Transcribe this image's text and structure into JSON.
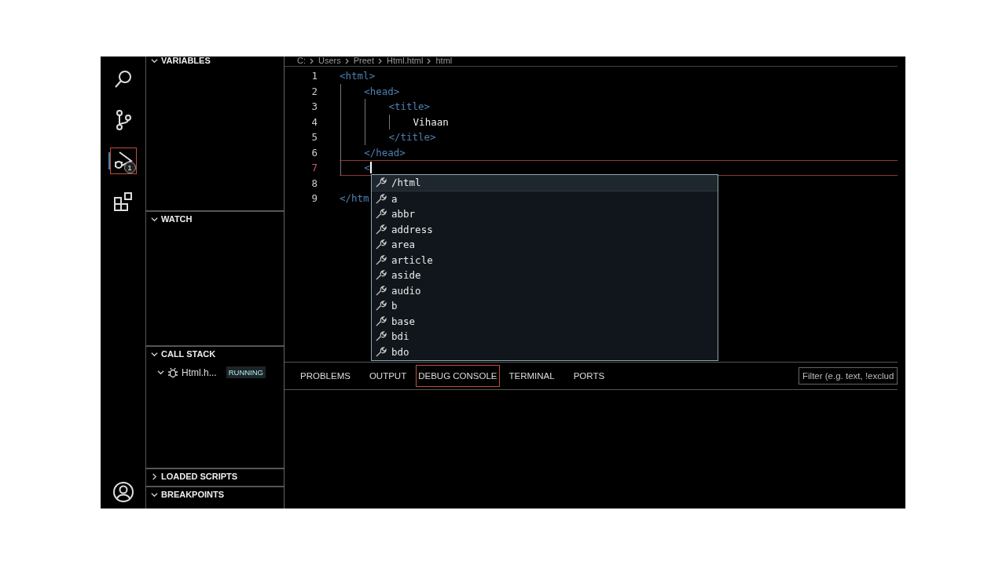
{
  "activity_bar": {
    "items": [
      {
        "kind": "search",
        "selected": false
      },
      {
        "kind": "source-control",
        "selected": false
      },
      {
        "kind": "run-debug",
        "selected": true,
        "badge": "1"
      },
      {
        "kind": "extensions",
        "selected": false
      }
    ],
    "account": {
      "kind": "account"
    }
  },
  "sidebar": {
    "sections": [
      {
        "title": "VARIABLES",
        "expanded": true
      },
      {
        "title": "WATCH",
        "expanded": true
      },
      {
        "title": "CALL STACK",
        "expanded": true,
        "items": [
          {
            "label": "Html.h...",
            "status": "RUNNING",
            "expanded": true
          }
        ]
      },
      {
        "title": "LOADED SCRIPTS",
        "expanded": false
      },
      {
        "title": "BREAKPOINTS",
        "expanded": true
      }
    ]
  },
  "breadcrumb": [
    "C:",
    "Users",
    "Preet",
    "Html.html",
    "html"
  ],
  "editor": {
    "lines": [
      {
        "number": "1",
        "text": "<html>",
        "kind": "tag",
        "current": false
      },
      {
        "number": "2",
        "text": "    <head>",
        "kind": "tag",
        "current": false
      },
      {
        "number": "3",
        "text": "        <title>",
        "kind": "tag",
        "current": false
      },
      {
        "number": "4",
        "text": "            Vihaan",
        "kind": "text",
        "current": false
      },
      {
        "number": "5",
        "text": "        </title>",
        "kind": "tag",
        "current": false
      },
      {
        "number": "6",
        "text": "    </head>",
        "kind": "tag",
        "current": false
      },
      {
        "number": "7",
        "text": "    <",
        "kind": "tag",
        "current": true
      },
      {
        "number": "8",
        "current": false
      },
      {
        "number": "9",
        "text": "</htm",
        "kind": "tag",
        "current": false
      }
    ]
  },
  "suggestions": [
    {
      "label": "/html",
      "selected": true
    },
    {
      "label": "a",
      "selected": false
    },
    {
      "label": "abbr",
      "selected": false
    },
    {
      "label": "address",
      "selected": false
    },
    {
      "label": "area",
      "selected": false
    },
    {
      "label": "article",
      "selected": false
    },
    {
      "label": "aside",
      "selected": false
    },
    {
      "label": "audio",
      "selected": false
    },
    {
      "label": "b",
      "selected": false
    },
    {
      "label": "base",
      "selected": false
    },
    {
      "label": "bdi",
      "selected": false
    },
    {
      "label": "bdo",
      "selected": false
    }
  ],
  "panel": {
    "tabs": [
      {
        "label": "PROBLEMS",
        "selected": false
      },
      {
        "label": "OUTPUT",
        "selected": false
      },
      {
        "label": "DEBUG CONSOLE",
        "selected": true
      },
      {
        "label": "TERMINAL",
        "selected": false
      },
      {
        "label": "PORTS",
        "selected": false
      }
    ],
    "filter": {
      "placeholder": "Filter (e.g. text, !exclud"
    }
  }
}
